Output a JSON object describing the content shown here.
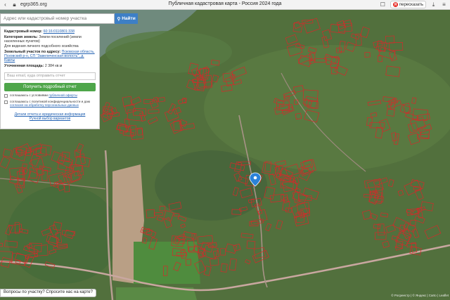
{
  "browser": {
    "url": "egrp365.org",
    "title": "Публичная кадастровая карта - Россия 2024 года",
    "translate_label": "пересказать",
    "icons": [
      "back-icon",
      "lock-icon",
      "bookmark-icon",
      "download-icon",
      "menu-icon"
    ]
  },
  "search": {
    "placeholder": "Адрес или кадастровый номер участка",
    "button_label": "Найти"
  },
  "panel": {
    "cadastral_label": "Кадастровый номер:",
    "cadastral_value": "60:16:0110801:338",
    "category_label": "Категория земель:",
    "category_value": "Земли поселений (земли населенных пунктов)",
    "use_value": "Для ведения личного подсобного хозяйства",
    "address_label": "Земельный участок по адресу:",
    "address_value": "Псковская область, Псковский р-н, СП \"Завеличенская волость\", д. Кавлы",
    "area_label": "Уточненная площадь:",
    "area_value": "2 384 кв.м",
    "email_placeholder": "Ваш email, куда отправить отчет",
    "report_button": "Получить подробный отчет",
    "consent_1a": "соглашаюсь с условиями",
    "consent_1b": "публичной оферты",
    "consent_2a": "соглашаюсь с политикой конфиденциальности и даю",
    "consent_2b": "согласие на обработку персональных данных",
    "details_link": "Детали отчета и юридическая информация",
    "manual_link": "Ручной выбор вариантов"
  },
  "map": {
    "ask_label": "Вопросы по участку? Спросите нас на карте?",
    "attribution": "© Росреестр | © Яндекс | Carto | Leaflet"
  },
  "colors": {
    "accent": "#3d7fc6",
    "report_button": "#4ea64a",
    "parcel_border": "#d42a2a",
    "marker": "#2c82d8",
    "road": "#c9a7a0"
  }
}
